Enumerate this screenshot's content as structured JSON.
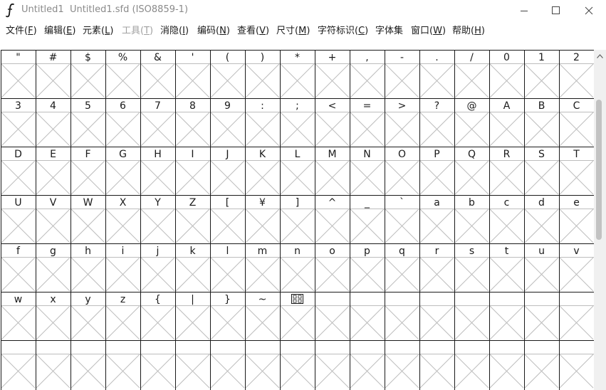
{
  "window": {
    "title": "Untitled1  Untitled1.sfd (ISO8859-1)",
    "app_icon": "fontforge-icon",
    "controls": [
      "minimize-icon",
      "maximize-icon",
      "close-icon"
    ]
  },
  "menu": [
    {
      "label": "文件",
      "hotkey": "F",
      "enabled": true,
      "name": "menu-file"
    },
    {
      "label": "编辑",
      "hotkey": "E",
      "enabled": true,
      "name": "menu-edit"
    },
    {
      "label": "元素",
      "hotkey": "L",
      "enabled": true,
      "name": "menu-element"
    },
    {
      "label": "工具",
      "hotkey": "T",
      "enabled": false,
      "name": "menu-tools"
    },
    {
      "label": "消隐",
      "hotkey": "I",
      "enabled": true,
      "name": "menu-hints"
    },
    {
      "label": "编码",
      "hotkey": "N",
      "enabled": true,
      "name": "menu-encoding"
    },
    {
      "label": "查看",
      "hotkey": "V",
      "enabled": true,
      "name": "menu-view"
    },
    {
      "label": "尺寸",
      "hotkey": "M",
      "enabled": true,
      "name": "menu-metrics"
    },
    {
      "label": "字符标识",
      "hotkey": "C",
      "enabled": true,
      "name": "menu-cid"
    },
    {
      "label": "字体集",
      "hotkey": "",
      "enabled": true,
      "name": "menu-mm"
    },
    {
      "label": "窗口",
      "hotkey": "W",
      "enabled": true,
      "name": "menu-window"
    },
    {
      "label": "帮助",
      "hotkey": "H",
      "enabled": true,
      "name": "menu-help"
    }
  ],
  "glyph_grid": {
    "columns": 17,
    "rows": [
      [
        "\"",
        "#",
        "$",
        "%",
        "&",
        "'",
        "(",
        ")",
        "*",
        "+",
        ",",
        "-",
        ".",
        "/",
        "0",
        "1",
        "2"
      ],
      [
        "3",
        "4",
        "5",
        "6",
        "7",
        "8",
        "9",
        ":",
        ";",
        "<",
        "=",
        ">",
        "?",
        "@",
        "A",
        "B",
        "C"
      ],
      [
        "D",
        "E",
        "F",
        "G",
        "H",
        "I",
        "J",
        "K",
        "L",
        "M",
        "N",
        "O",
        "P",
        "Q",
        "R",
        "S",
        "T"
      ],
      [
        "U",
        "V",
        "W",
        "X",
        "Y",
        "Z",
        "[",
        "¥",
        "]",
        "^",
        "_",
        "`",
        "a",
        "b",
        "c",
        "d",
        "e"
      ],
      [
        "f",
        "g",
        "h",
        "i",
        "j",
        "k",
        "l",
        "m",
        "n",
        "o",
        "p",
        "q",
        "r",
        "s",
        "t",
        "u",
        "v"
      ],
      [
        "w",
        "x",
        "y",
        "z",
        "{",
        "|",
        "}",
        "~",
        "DEL",
        "",
        "",
        "",
        "",
        "",
        "",
        "",
        ""
      ],
      [
        "",
        "",
        "",
        "",
        "",
        "",
        "",
        "",
        "",
        "",
        "",
        "",
        "",
        "",
        "",
        "",
        ""
      ]
    ],
    "empty_marker": "missing-glyph-cross",
    "colors": {
      "line": "#1a1a1a",
      "cross": "#bdbdbd"
    }
  },
  "scrollbar": {
    "orientation": "vertical",
    "position": 0.15
  }
}
